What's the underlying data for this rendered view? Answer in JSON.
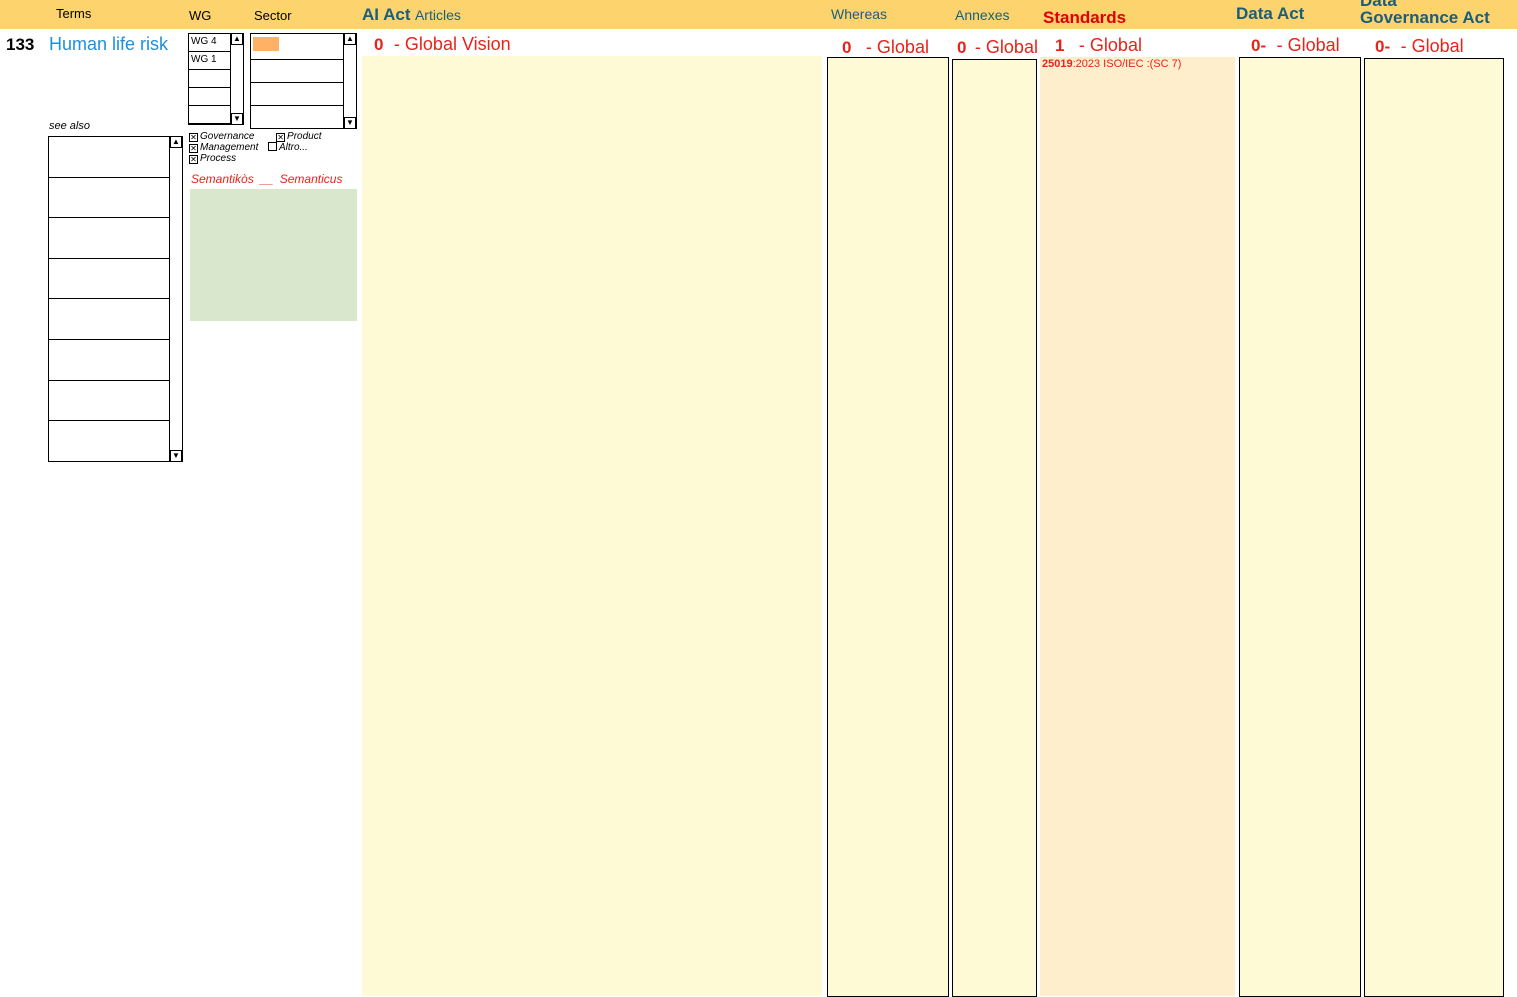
{
  "header": {
    "terms": "Terms",
    "wg": "WG",
    "sector": "Sector",
    "ai_act": "AI Act",
    "articles": "Articles",
    "whereas": "Whereas",
    "annexes": "Annexes",
    "standards": "Standards",
    "data_act": "Data Act",
    "data_gov_line1": "Data",
    "data_gov_line2": "Governance Act"
  },
  "term": {
    "number": "133",
    "name": "Human life risk",
    "see_also_label": "see also"
  },
  "wg_list": [
    "WG 4",
    "WG 1",
    "",
    "",
    ""
  ],
  "sector_list": [
    "",
    "",
    "",
    ""
  ],
  "sector_selected_color": "#FFB266",
  "checkboxes": {
    "governance": {
      "label": "Governance",
      "checked": true
    },
    "product": {
      "label": "Product",
      "checked": true
    },
    "management": {
      "label": "Management",
      "checked": true
    },
    "altro": {
      "label": "Altro...",
      "checked": false
    },
    "process": {
      "label": "Process",
      "checked": true
    }
  },
  "semantics": {
    "left": "Semantikòs",
    "sep": "__",
    "right": "Semanticus"
  },
  "columns": {
    "ai_act": {
      "count": "0",
      "label": "- Global Vision"
    },
    "whereas": {
      "count": "0",
      "label": "- Global"
    },
    "annexes": {
      "count": "0",
      "label": "- Global"
    },
    "standards": {
      "count": "1",
      "label": "- Global",
      "entry_code": "25019",
      "entry_rest": ":2023 ISO/IEC :(SC 7)"
    },
    "data_act": {
      "count": "0-",
      "label": "- Global"
    },
    "data_gov": {
      "count": "0-",
      "label": "- Global"
    }
  },
  "colors": {
    "header": "#FDD36E",
    "cream": "#FFFAD6",
    "peach": "#FFEECC",
    "green": "#D9E8CD",
    "teal": "#1A5E7A",
    "red": "#E8231B",
    "link_blue": "#1E8FE0"
  }
}
